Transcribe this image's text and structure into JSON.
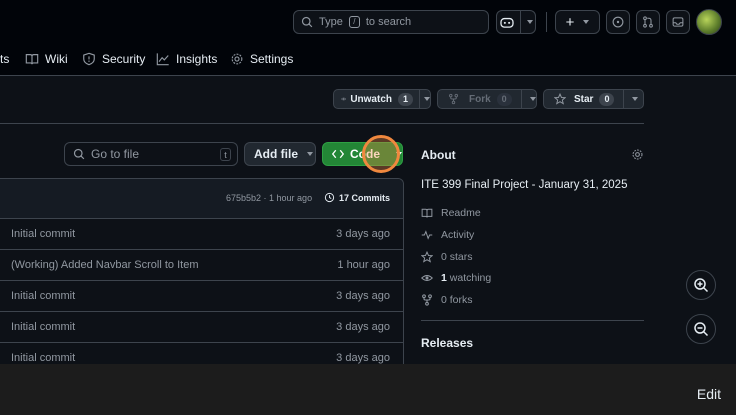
{
  "topbar": {
    "search_prefix": "Type",
    "search_key": "/",
    "search_suffix": "to search",
    "plus_label": "+"
  },
  "reponav": {
    "items": [
      {
        "label": "ts"
      },
      {
        "label": "Wiki"
      },
      {
        "label": "Security"
      },
      {
        "label": "Insights"
      },
      {
        "label": "Settings"
      }
    ]
  },
  "actions": {
    "watch_label": "Unwatch",
    "watch_count": "1",
    "fork_label": "Fork",
    "fork_count": "0",
    "star_label": "Star",
    "star_count": "0"
  },
  "toolbar": {
    "go_to_file_placeholder": "Go to file",
    "go_to_file_key": "t",
    "add_file_label": "Add file",
    "code_label": "Code"
  },
  "files": {
    "commit_hash": "675b5b2 · 1 hour ago",
    "commits_label": "17 Commits",
    "rows": [
      {
        "message": "Initial commit",
        "age": "3 days ago"
      },
      {
        "message": "(Working) Added Navbar Scroll to Item",
        "age": "1 hour ago"
      },
      {
        "message": "Initial commit",
        "age": "3 days ago"
      },
      {
        "message": "Initial commit",
        "age": "3 days ago"
      },
      {
        "message": "Initial commit",
        "age": "3 days ago"
      }
    ]
  },
  "about": {
    "title": "About",
    "description": "ITE 399 Final Project - January 31, 2025",
    "readme": "Readme",
    "activity": "Activity",
    "stars": "0 stars",
    "watching_count": "1",
    "watching_label": "watching",
    "forks": "0 forks",
    "releases": "Releases"
  },
  "bottom": {
    "edit_label": "Edit"
  },
  "colors": {
    "bg": "#0d1117",
    "header": "#010409",
    "accent_green": "#238636",
    "highlight": "#f0883e",
    "border": "#3d444d"
  }
}
